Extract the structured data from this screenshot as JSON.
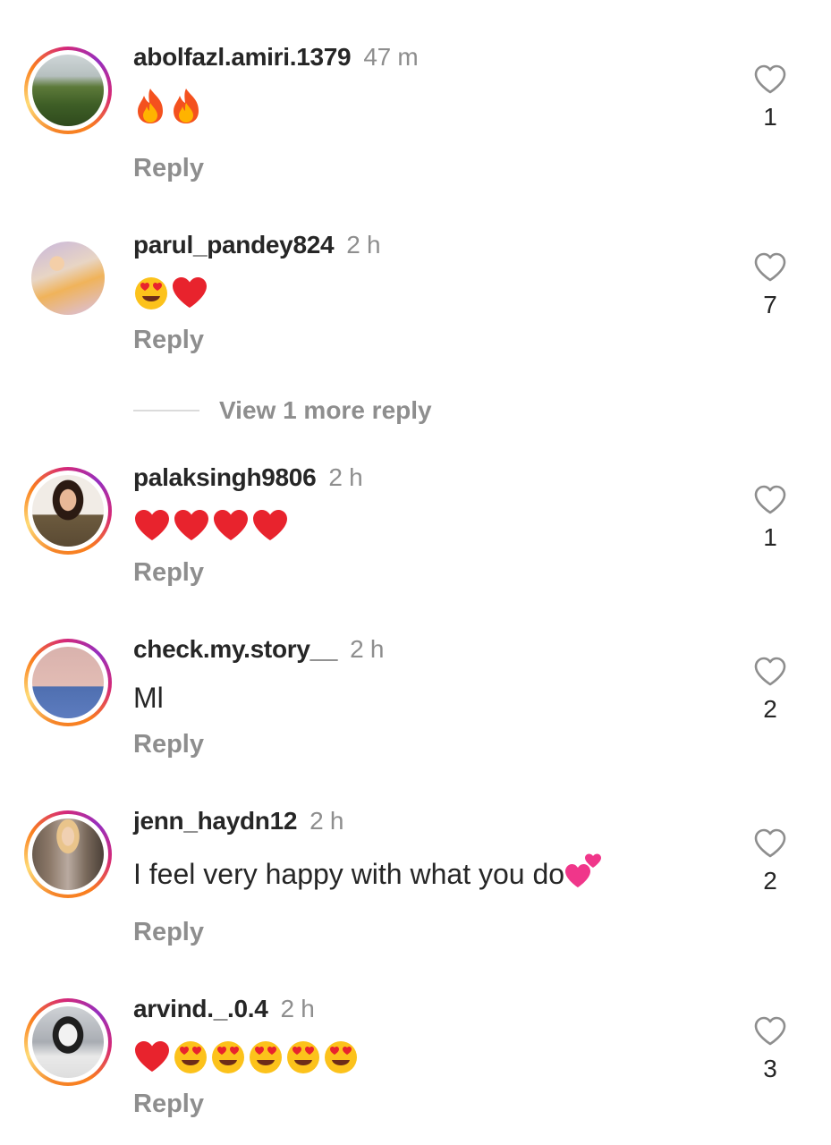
{
  "comments": [
    {
      "username": "abolfazl.amiri.1379",
      "time": "47 m",
      "text": "",
      "emojis": [
        "fire",
        "fire"
      ],
      "likes": "1",
      "reply": "Reply",
      "ring": true
    },
    {
      "username": "parul_pandey824",
      "time": "2 h",
      "text": "",
      "emojis": [
        "heart-eyes",
        "red-heart"
      ],
      "likes": "7",
      "reply": "Reply",
      "ring": false
    },
    {
      "username": "palaksingh9806",
      "time": "2 h",
      "text": "",
      "emojis": [
        "red-heart",
        "red-heart",
        "red-heart",
        "red-heart"
      ],
      "likes": "1",
      "reply": "Reply",
      "ring": true
    },
    {
      "username": "check.my.story__",
      "time": "2 h",
      "text": "Ml",
      "emojis": [],
      "likes": "2",
      "reply": "Reply",
      "ring": true
    },
    {
      "username": "jenn_haydn12",
      "time": "2 h",
      "text": "I feel very happy with what you do",
      "emojis": [
        "two-hearts"
      ],
      "likes": "2",
      "reply": "Reply",
      "ring": true
    },
    {
      "username": "arvind._.0.4",
      "time": "2 h",
      "text": "",
      "emojis": [
        "red-heart",
        "heart-eyes",
        "heart-eyes",
        "heart-eyes",
        "heart-eyes",
        "heart-eyes"
      ],
      "likes": "3",
      "reply": "Reply",
      "ring": true
    }
  ],
  "view_more": "View 1 more reply",
  "colors": {
    "heart_red": "#e8232d",
    "muted": "#8e8e8e",
    "text": "#262626"
  }
}
